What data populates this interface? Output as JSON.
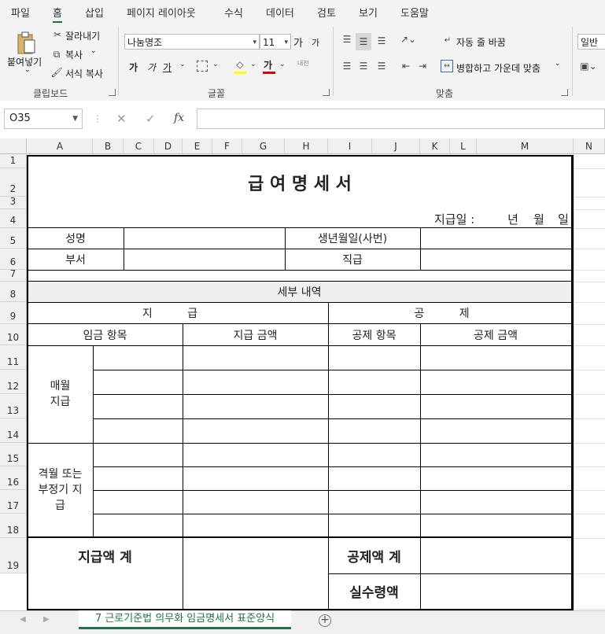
{
  "menu": {
    "tabs": [
      "파일",
      "홈",
      "삽입",
      "페이지 레이아웃",
      "수식",
      "데이터",
      "검토",
      "보기",
      "도움말"
    ],
    "active": "홈"
  },
  "ribbon": {
    "clipboard": {
      "paste": "붙여넣기",
      "cut": "잘라내기",
      "copy": "복사",
      "format_painter": "서식 복사",
      "label": "클립보드"
    },
    "font": {
      "name": "나눔명조",
      "size": "11",
      "grow": "가",
      "shrink": "가",
      "bold": "가",
      "italic": "가",
      "underline": "가",
      "font_color_glyph": "가",
      "phonetic": "내천",
      "label": "글꼴",
      "fill_color": "#ffff00",
      "font_color": "#e00000"
    },
    "alignment": {
      "wrap_text": "자동 줄 바꿈",
      "merge_center": "병합하고 가운데 맞춤",
      "label": "맞춤"
    },
    "number": {
      "format": "일반"
    }
  },
  "formula_bar": {
    "name_box": "O35",
    "fx": "fx",
    "value": ""
  },
  "columns": [
    "A",
    "B",
    "C",
    "D",
    "E",
    "F",
    "G",
    "H",
    "I",
    "J",
    "K",
    "L",
    "M",
    "N"
  ],
  "rows": [
    "1",
    "2",
    "3",
    "4",
    "5",
    "6",
    "7",
    "8",
    "9",
    "10",
    "11",
    "12",
    "13",
    "14",
    "15",
    "16",
    "17",
    "18",
    "19"
  ],
  "sheet": {
    "title": "급 여 명 세 서",
    "pay_date": "지급일 :",
    "year": "년",
    "month": "월",
    "day": "일",
    "name_label": "성명",
    "birth_label": "생년월일(사번)",
    "dept_label": "부서",
    "rank_label": "직급",
    "details": "세부 내역",
    "pay_header": "지 급",
    "deduct_header": "공 제",
    "wage_item": "임금 항목",
    "pay_amount": "지급 금액",
    "deduct_item": "공제 항목",
    "deduct_amount": "공제 금액",
    "monthly": "매월\n지급",
    "irregular": "격월 또는\n부정기 지\n급",
    "total_pay": "지급액 계",
    "total_deduct": "공제액 계",
    "net_pay": "실수령액"
  },
  "sheet_tab": "7 근로기준법 의무화 임금명세서 표준양식"
}
